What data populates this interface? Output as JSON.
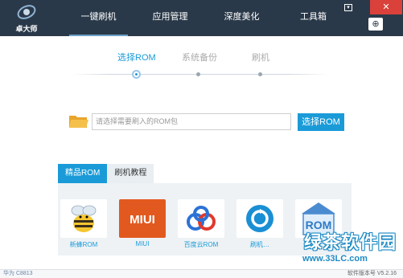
{
  "app": {
    "name": "卓大师"
  },
  "nav": [
    {
      "label": "一键刷机"
    },
    {
      "label": "应用管理"
    },
    {
      "label": "深度美化"
    },
    {
      "label": "工具箱"
    }
  ],
  "window": {
    "min_glyph": "▾",
    "close_glyph": "✕",
    "download_glyph": "⊕"
  },
  "steps": [
    {
      "label": "选择ROM"
    },
    {
      "label": "系统备份"
    },
    {
      "label": "刷机"
    }
  ],
  "rom_picker": {
    "placeholder": "请选择需要刷入的ROM包",
    "button": "选择ROM",
    "folder_icon": "folder-icon"
  },
  "tabs": [
    {
      "label": "精品ROM"
    },
    {
      "label": "刷机教程"
    }
  ],
  "apps": [
    {
      "name": "新蜂ROM",
      "icon": "bee-icon"
    },
    {
      "name": "MIUI",
      "icon": "miui-icon"
    },
    {
      "name": "百度云ROM",
      "icon": "baidu-cloud-icon"
    },
    {
      "name": "刷机…",
      "icon": "refresh-icon"
    },
    {
      "name": "",
      "icon": "rom-house-icon"
    }
  ],
  "footer": {
    "device": "华为 C8813",
    "version": "软件版本号 V5.2.16"
  },
  "watermark": {
    "title": "绿茶软件园",
    "url": "www.33LC.com"
  },
  "colors": {
    "header": "#2a3949",
    "accent": "#1a9bd8",
    "close": "#d9413a"
  }
}
